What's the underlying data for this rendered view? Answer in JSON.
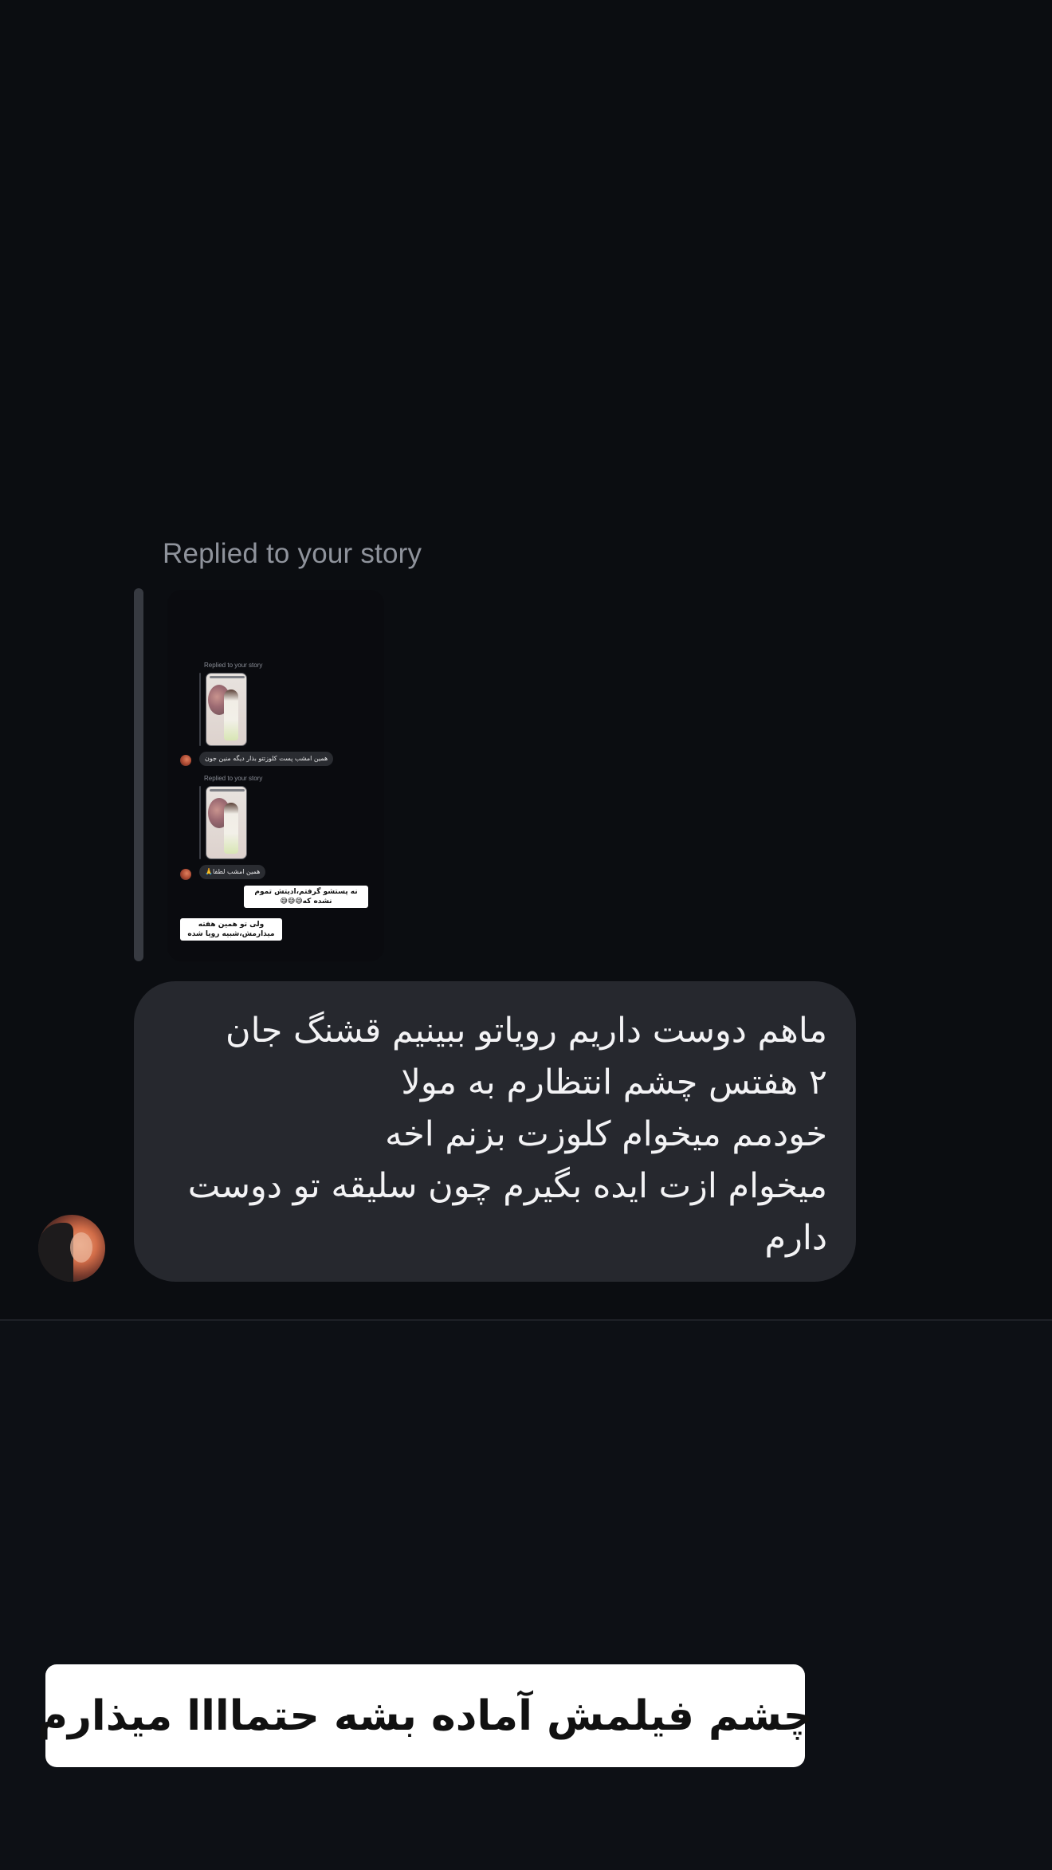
{
  "story_reply": {
    "label": "Replied to your story",
    "nested_thumbnail": {
      "items": [
        {
          "label": "Replied to your story",
          "bubble": "همین امشب پست کلوزتتو بذار دیگه منین جون"
        },
        {
          "label": "Replied to your story",
          "bubble": "همین امشب لطفا🙏"
        }
      ],
      "stickers": [
        "نه پستشو گرفتم،ادیتش تموم نشده که😅😅😅",
        "ولی تو همین هفته میذارمش،شبیه رویا شده"
      ]
    }
  },
  "message": {
    "text": "ماهم دوست داریم رویاتو ببینیم قشنگ جان\n۲ هفتس چشم انتظارم به مولا\nخودمم میخوام کلوزت بزنم اخه\nمیخوام ازت ایده بگیرم چون سلیقه تو دوست دارم"
  },
  "caption": {
    "text": "چشم فیلمش آماده بشه حتماااا میذارم"
  },
  "colors": {
    "background": "#0d1015",
    "bubble": "#26282e",
    "label": "#8f939c",
    "caption_bg": "#ffffff"
  }
}
